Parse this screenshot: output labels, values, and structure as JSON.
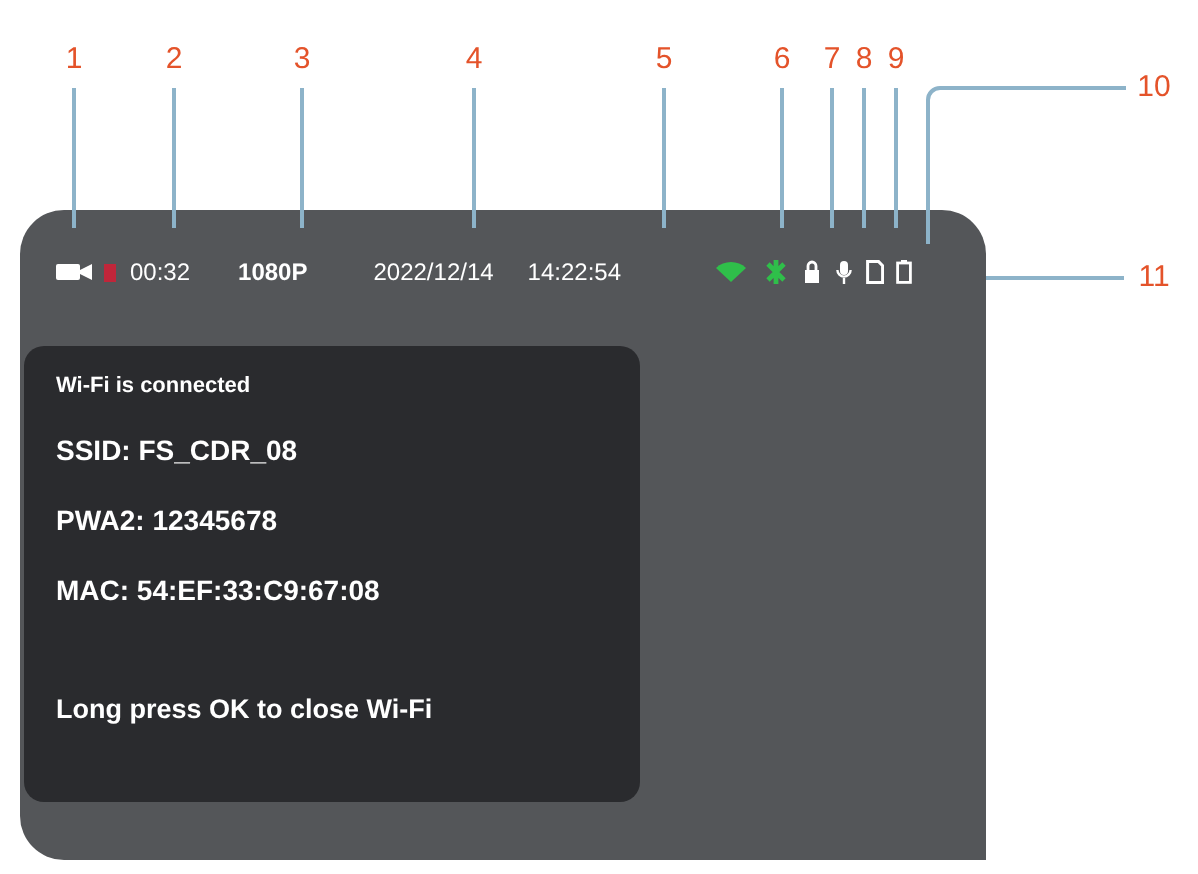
{
  "callouts": [
    {
      "label": "1"
    },
    {
      "label": "2"
    },
    {
      "label": "3"
    },
    {
      "label": "4"
    },
    {
      "label": "5"
    },
    {
      "label": "6"
    },
    {
      "label": "7"
    },
    {
      "label": "8"
    },
    {
      "label": "9"
    },
    {
      "label": "10"
    },
    {
      "label": "11"
    }
  ],
  "status_bar": {
    "recording": true,
    "elapsed": "00:32",
    "resolution": "1080P",
    "date": "2022/12/14",
    "time": "14:22:54",
    "wifi_on": true,
    "gps_on": true
  },
  "wifi_panel": {
    "title": "Wi-Fi is connected",
    "lines": [
      "SSID: FS_CDR_08",
      "PWA2: 12345678",
      "MAC: 54:EF:33:C9:67:08"
    ],
    "hint": "Long press OK to close Wi-Fi"
  }
}
